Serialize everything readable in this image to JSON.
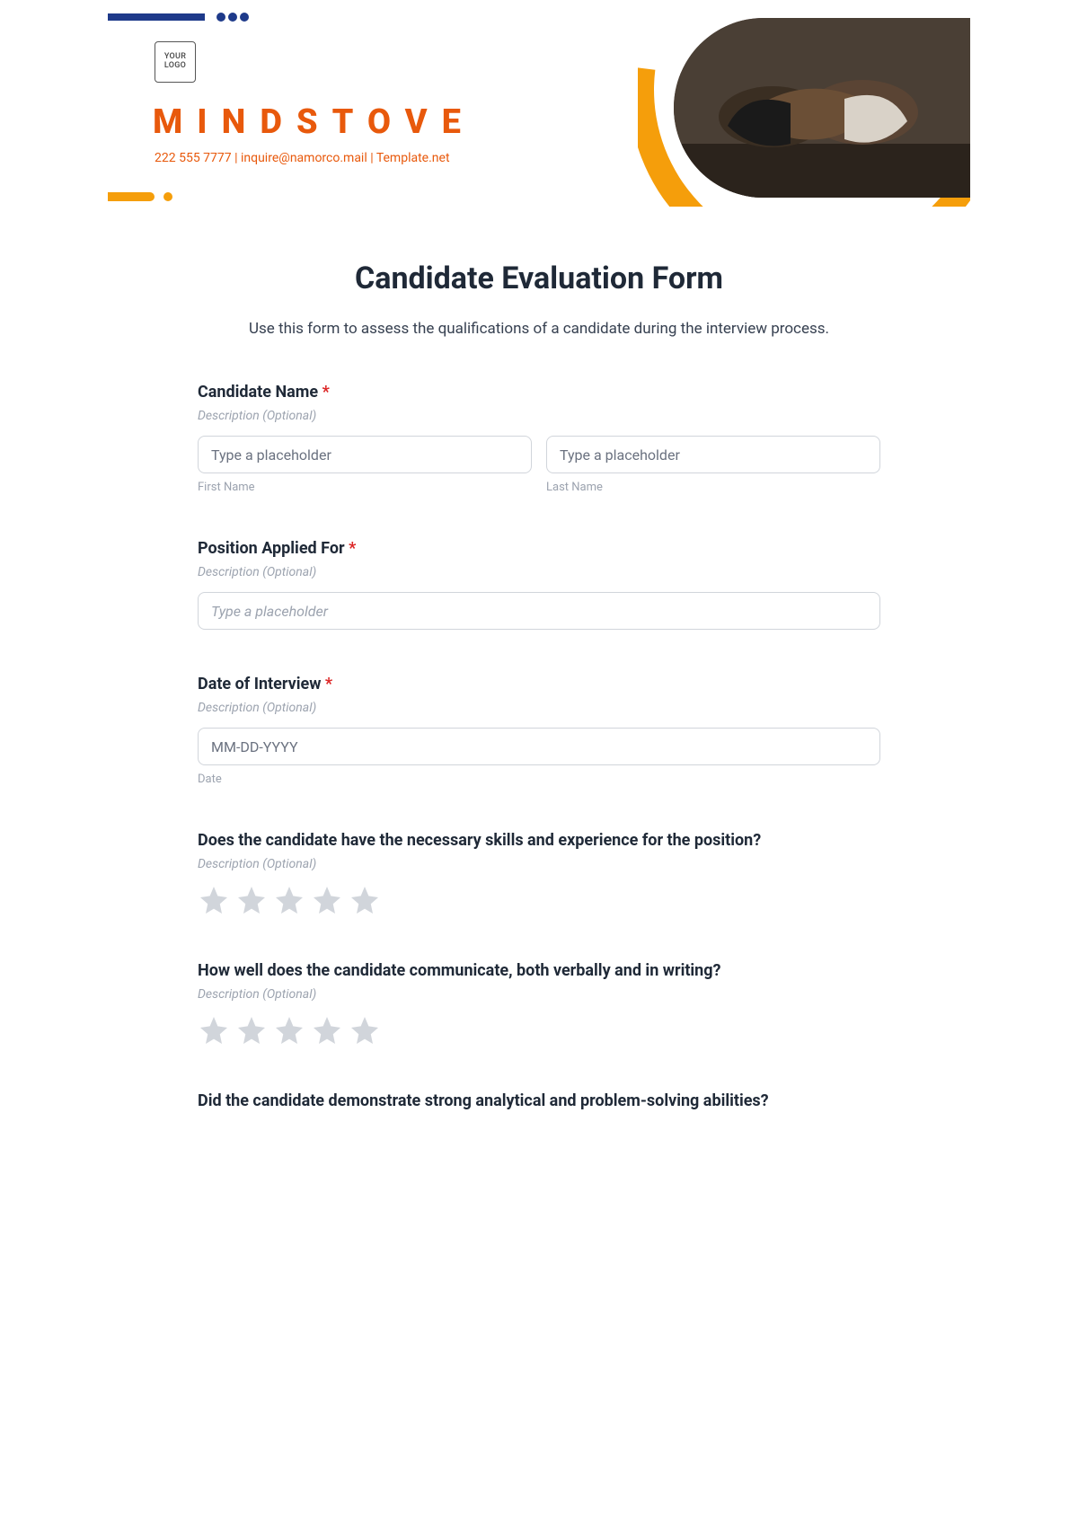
{
  "header": {
    "logo_placeholder": "YOUR\nLOGO",
    "brand": "MINDSTOVE",
    "contact": "222 555 7777  |  inquire@namorco.mail  |  Template.net"
  },
  "form": {
    "title": "Candidate Evaluation Form",
    "description": "Use this form to assess the qualifications of a candidate during the interview process.",
    "desc_optional": "Description (Optional)",
    "required_mark": "*",
    "fields": {
      "candidate_name": {
        "label": "Candidate Name",
        "first_placeholder": "Type a placeholder",
        "first_sub": "First Name",
        "last_placeholder": "Type a placeholder",
        "last_sub": "Last Name"
      },
      "position": {
        "label": "Position Applied For",
        "placeholder": "Type a placeholder"
      },
      "date": {
        "label": "Date of Interview",
        "placeholder": "MM-DD-YYYY",
        "sub": "Date"
      },
      "q1": {
        "label": "Does the candidate have the necessary skills and experience for the position?"
      },
      "q2": {
        "label": "How well does the candidate communicate, both verbally and in writing?"
      },
      "q3": {
        "label": "Did the candidate demonstrate strong analytical and problem-solving abilities?"
      }
    }
  }
}
